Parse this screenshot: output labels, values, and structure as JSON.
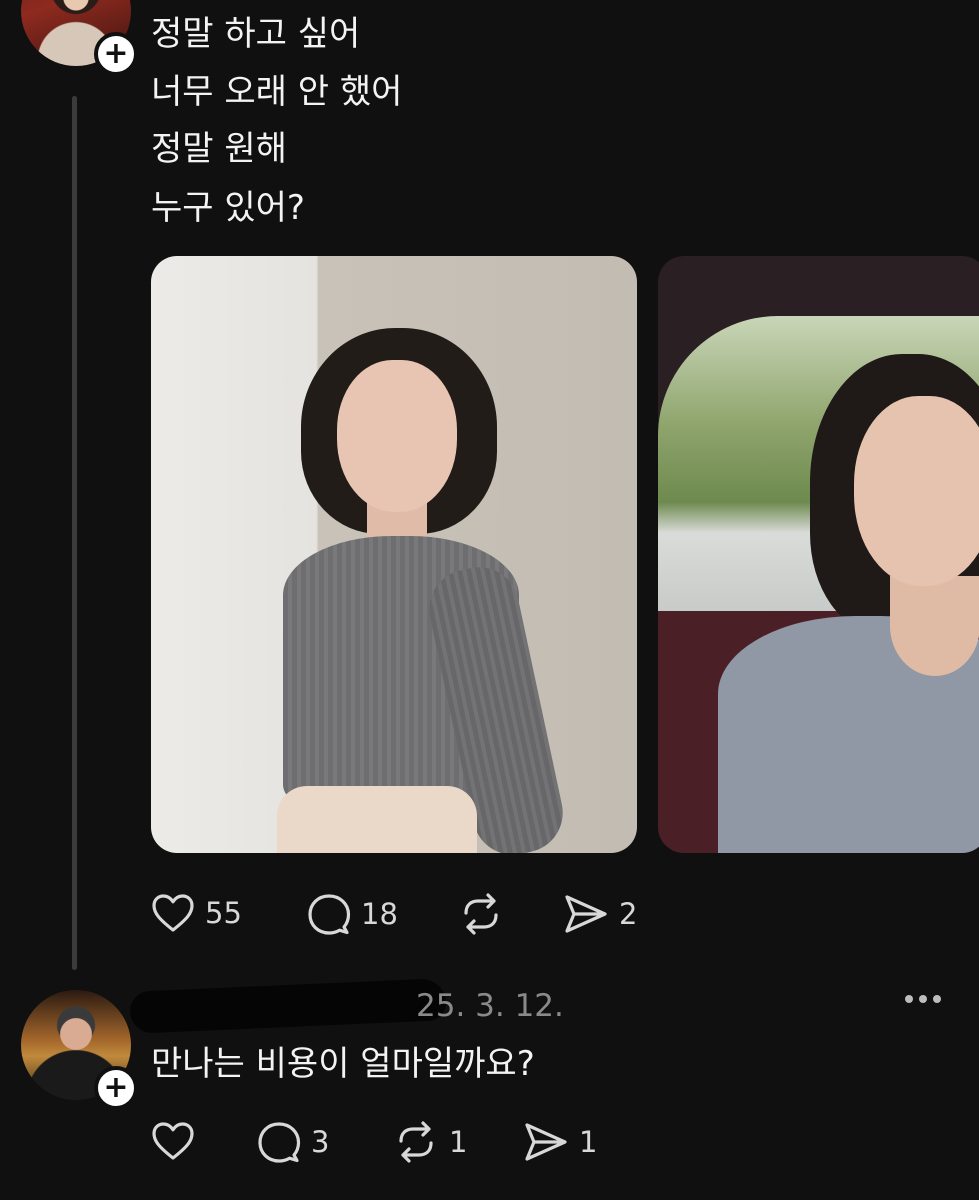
{
  "post": {
    "lines": [
      "정말 하고 싶어",
      "너무 오래 안 했어",
      "정말 원해",
      "누구 있어?"
    ],
    "actions": {
      "likes": "55",
      "comments": "18",
      "reposts": "",
      "shares": "2"
    }
  },
  "reply": {
    "date": "25. 3. 12.",
    "text": "만나는 비용이 얼마일까요?",
    "actions": {
      "likes": "",
      "comments": "3",
      "reposts": "1",
      "shares": "1"
    }
  },
  "icons": [
    "heart-icon",
    "comment-icon",
    "repost-icon",
    "share-icon",
    "more-icon",
    "plus-icon"
  ],
  "colors": {
    "background": "#101010",
    "text": "#f3f3f3",
    "muted": "#8a8a8a",
    "thread_line": "#3b3b3b"
  }
}
